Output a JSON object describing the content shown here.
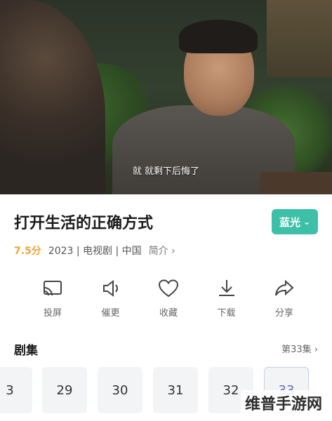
{
  "video": {
    "subtitle": "就 就剩下后悔了"
  },
  "show": {
    "title": "打开生活的正确方式",
    "quality_label": "蓝光",
    "score": "7.5分",
    "meta": "2023 | 电视剧 | 中国",
    "intro_label": "简介 ›"
  },
  "actions": [
    {
      "label": "投屏",
      "icon": "cast-icon"
    },
    {
      "label": "催更",
      "icon": "speaker-icon"
    },
    {
      "label": "收藏",
      "icon": "heart-icon"
    },
    {
      "label": "下载",
      "icon": "download-icon"
    },
    {
      "label": "分享",
      "icon": "share-icon"
    }
  ],
  "episodes": {
    "section_title": "剧集",
    "more_label": "第33集 ›",
    "items": [
      "3",
      "29",
      "30",
      "31",
      "32",
      "33"
    ],
    "active": "33"
  },
  "watermark": "维普手游网",
  "colors": {
    "accent": "#3ec0a8",
    "score": "#f0a634",
    "active_episode": "#5f6bc8"
  }
}
